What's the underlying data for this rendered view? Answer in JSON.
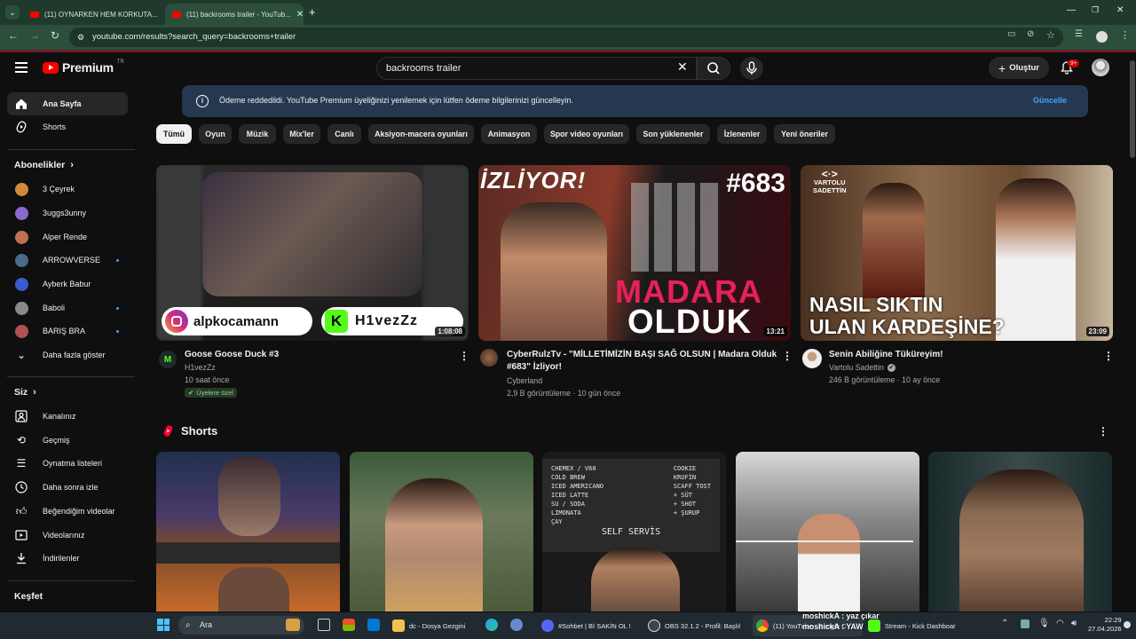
{
  "browser": {
    "tabs": [
      {
        "label": "(11) OYNARKEN HEM KORKUTA..."
      },
      {
        "label": "(11) backrooms trailer - YouTub..."
      }
    ],
    "url": "youtube.com/results?search_query=backrooms+trailer"
  },
  "header": {
    "logo_text": "Premium",
    "logo_sup": "TR",
    "search_value": "backrooms trailer",
    "create_label": "Oluştur",
    "notif_badge": "9+"
  },
  "sidebar": {
    "main": [
      {
        "label": "Ana Sayfa",
        "icon": "home-icon"
      },
      {
        "label": "Shorts",
        "icon": "shorts-icon"
      }
    ],
    "subs_title": "Abonelikler",
    "subs": [
      {
        "label": "3 Çeyrek",
        "color": "#d08a3a",
        "dot": false
      },
      {
        "label": "3uggs3unny",
        "color": "#8a6ad0",
        "dot": false
      },
      {
        "label": "Alper Rende",
        "color": "#c07050",
        "dot": false
      },
      {
        "label": "ARROWVERSE",
        "color": "#4a6a8a",
        "dot": true
      },
      {
        "label": "Ayberk Babur",
        "color": "#3a5ad0",
        "dot": false
      },
      {
        "label": "Baboli",
        "color": "#8a8a8a",
        "dot": true
      },
      {
        "label": "BARIŞ BRA",
        "color": "#b05050",
        "dot": true
      }
    ],
    "show_more": "Daha fazla göster",
    "you_title": "Siz",
    "you": [
      {
        "label": "Kanalınız",
        "icon": "channel-icon"
      },
      {
        "label": "Geçmiş",
        "icon": "history-icon"
      },
      {
        "label": "Oynatma listeleri",
        "icon": "playlist-icon"
      },
      {
        "label": "Daha sonra izle",
        "icon": "clock-icon"
      },
      {
        "label": "Beğendiğim videolar",
        "icon": "like-icon"
      },
      {
        "label": "Videolarınız",
        "icon": "video-icon"
      },
      {
        "label": "İndirilenler",
        "icon": "download-icon"
      }
    ],
    "explore_title": "Keşfet"
  },
  "banner": {
    "text": "Ödeme reddedildi. YouTube Premium üyeliğinizi yenilemek için lütfen ödeme bilgilerinizi güncelleyin.",
    "action": "Güncelle"
  },
  "chips": [
    "Tümü",
    "Oyun",
    "Müzik",
    "Mix'ler",
    "Canlı",
    "Aksiyon-macera oyunları",
    "Animasyon",
    "Spor video oyunları",
    "Son yüklenenler",
    "İzlenenler",
    "Yeni öneriler"
  ],
  "videos": [
    {
      "title": "Goose Goose Duck #3",
      "channel": "H1vezZz",
      "meta": "10 saat önce",
      "badge": "Üyelere özel",
      "duration": "1:08:08",
      "thumb_left_tag": "alpkocamann",
      "thumb_right_tag": "H1vezZz"
    },
    {
      "title": "CyberRulzTv - \"MİLLETİMİZİN BAŞI SAĞ OLSUN | Madara Olduk #683\" İzliyor!",
      "channel": "Cyberland",
      "meta": "2,9 B görüntüleme · 10 gün önce",
      "duration": "13:21",
      "thumb_top": "İZLİYOR!",
      "thumb_num": "#683",
      "thumb_big1": "MADARA",
      "thumb_big2": "OLDUK"
    },
    {
      "title": "Senin Abiliğine Tüküreyim!",
      "channel": "Vartolu Sadettin",
      "meta": "246 B görüntüleme · 10 ay önce",
      "duration": "23:09",
      "thumb_logo1": "VARTOLU",
      "thumb_logo2": "SADETTİN",
      "thumb_line1": "NASIL SIKTIN",
      "thumb_line2": "ULAN KARDEŞİNE?"
    }
  ],
  "shorts": {
    "title": "Shorts",
    "menu_text": [
      "CHEMEX / V60",
      "COLD BREW",
      "ICED AMERICANO",
      "ICED LATTE",
      "SU / SODA",
      "LIMONATA",
      "ÇAY",
      "COOKIE",
      "KRUFİN",
      "SCAFF TOST",
      "+ SÜT",
      "+ SHOT",
      "+ ŞURUP",
      "SELF SERVİS"
    ]
  },
  "taskbar": {
    "search": "Ara",
    "apps": [
      {
        "label": "dc - Dosya Gezgini",
        "color": "#f2c14e"
      },
      {
        "label": "#Sohbet | Bİ SAKİN OL !",
        "color": "#5865f2"
      },
      {
        "label": "OBS 32.1.2 - Profil: Başlıl",
        "color": "#444"
      },
      {
        "label": "(11) YouTube - Google C",
        "color": "#e8b04a"
      },
      {
        "label": "Stream - Kick Dashboar",
        "color": "#53fc18"
      }
    ],
    "chat": [
      "moshickA : yaz çıkar",
      "moshickA : YAW"
    ],
    "time": "22:29",
    "date": "27.04.2026"
  }
}
